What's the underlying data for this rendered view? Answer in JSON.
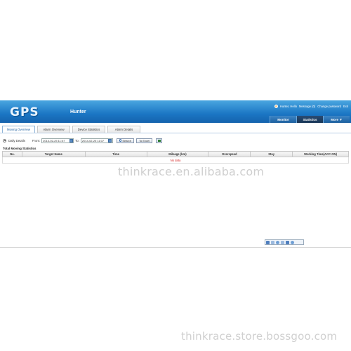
{
  "header": {
    "logo": "GPS",
    "app_name": "Hunter",
    "top_links": [
      "Hunter, Hello",
      "Message (0)",
      "Change password",
      "Exit"
    ],
    "nav": [
      {
        "label": "Monitor"
      },
      {
        "label": "Statistics"
      },
      {
        "label": "More ▼"
      }
    ]
  },
  "tabs": [
    "Moving Overview",
    "Alarm Overview",
    "Device Statistics",
    "Alarm Details"
  ],
  "filter": {
    "radio_label": "Daily Details",
    "from_label": "From:",
    "from_value": "2014-02-25 11:07",
    "to_label": "To:",
    "to_value": "2014-02-25 11:07",
    "search_label": "Search",
    "excel_label": "To Excel"
  },
  "table": {
    "title": "Total Moving Statistics",
    "columns": [
      "No.",
      "Target Name",
      "Time",
      "Mileage (km)",
      "Overspeed",
      "Stay",
      "Working Time(ACC ON)"
    ],
    "empty_text": "No data"
  },
  "watermark_mid": "thinkrace.en.alibaba.com",
  "watermark_bottom": "thinkrace.store.bossgoo.com",
  "colors": {
    "header_blue": "#1b76c4",
    "nav_active": "#163455",
    "empty_text": "#d42020"
  }
}
